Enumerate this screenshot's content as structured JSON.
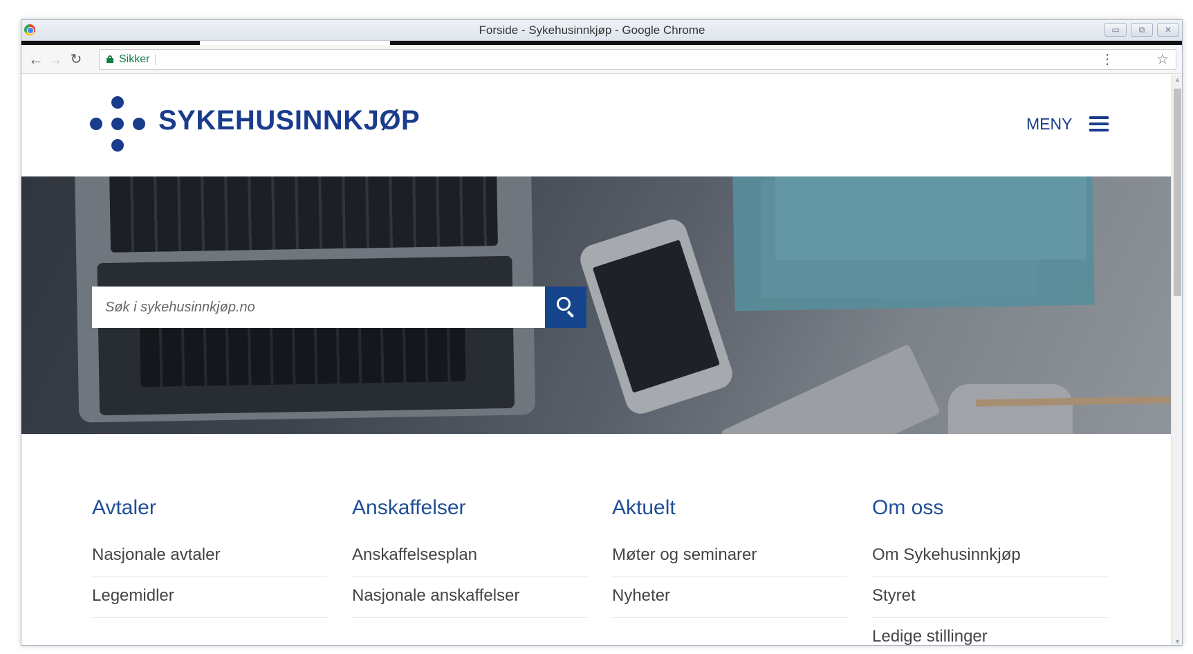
{
  "browser": {
    "window_title": "Forside - Sykehusinnkjøp - Google Chrome",
    "secure_label": "Sikker",
    "window_buttons": [
      "▭",
      "⧉",
      "✕"
    ]
  },
  "header": {
    "logo_text": "SYKEHUSINNKJØP",
    "menu_label": "MENY",
    "brand_color": "#1a3c8c"
  },
  "search": {
    "placeholder": "Søk i sykehusinnkjøp.no",
    "button_color": "#16458c"
  },
  "nav_columns": [
    {
      "title": "Avtaler",
      "links": [
        "Nasjonale avtaler",
        "Legemidler"
      ]
    },
    {
      "title": "Anskaffelser",
      "links": [
        "Anskaffelsesplan",
        "Nasjonale anskaffelser"
      ]
    },
    {
      "title": "Aktuelt",
      "links": [
        "Møter og seminarer",
        "Nyheter"
      ]
    },
    {
      "title": "Om oss",
      "links": [
        "Om Sykehusinnkjøp",
        "Styret",
        "Ledige stillinger"
      ]
    }
  ]
}
